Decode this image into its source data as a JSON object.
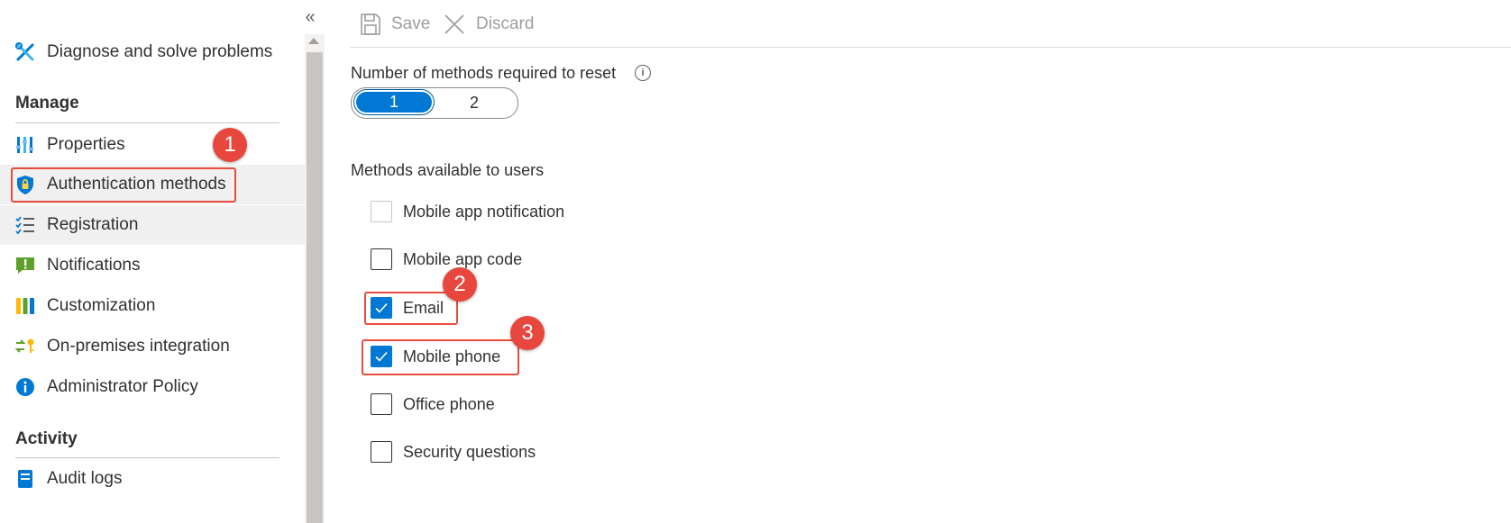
{
  "sidebar": {
    "collapse_glyph": "«",
    "top_item": {
      "label": "Diagnose and solve problems",
      "icon": "wrench-screwdriver-icon"
    },
    "sections": [
      {
        "title": "Manage"
      },
      {
        "title": "Activity"
      }
    ],
    "items": [
      {
        "label": "Properties",
        "icon": "properties-icon"
      },
      {
        "label": "Authentication methods",
        "icon": "shield-lock-icon"
      },
      {
        "label": "Registration",
        "icon": "checklist-icon"
      },
      {
        "label": "Notifications",
        "icon": "notification-icon"
      },
      {
        "label": "Customization",
        "icon": "customization-icon"
      },
      {
        "label": "On-premises integration",
        "icon": "sync-key-icon"
      },
      {
        "label": "Administrator Policy",
        "icon": "info-icon"
      },
      {
        "label": "Audit logs",
        "icon": "audit-log-icon"
      }
    ]
  },
  "toolbar": {
    "save_label": "Save",
    "discard_label": "Discard"
  },
  "reset": {
    "label": "Number of methods required to reset",
    "info_glyph": "i",
    "options": [
      "1",
      "2"
    ],
    "selected": "1"
  },
  "methods": {
    "label": "Methods available to users",
    "items": [
      {
        "label": "Mobile app notification",
        "checked": false
      },
      {
        "label": "Mobile app code",
        "checked": false
      },
      {
        "label": "Email",
        "checked": true
      },
      {
        "label": "Mobile phone",
        "checked": true
      },
      {
        "label": "Office phone",
        "checked": false
      },
      {
        "label": "Security questions",
        "checked": false
      }
    ]
  },
  "annotations": {
    "badge1": "1",
    "badge2": "2",
    "badge3": "3"
  },
  "colors": {
    "accent": "#0078d4",
    "annotation": "#e8473d",
    "selected_bg": "#f0f0f0"
  }
}
